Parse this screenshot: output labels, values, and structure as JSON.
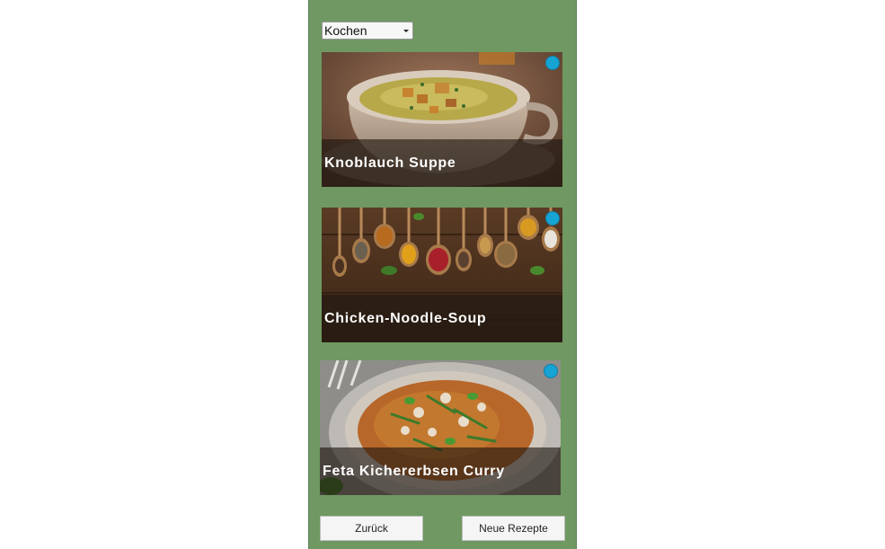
{
  "category_select": {
    "value": "Kochen"
  },
  "recipes": [
    {
      "title": "Knoblauch Suppe",
      "image": "garlic-soup-bowl",
      "marker_color": "#16a4d4"
    },
    {
      "title": "Chicken-Noodle-Soup",
      "image": "spice-spoons-on-wood",
      "marker_color": "#16a4d4"
    },
    {
      "title": "Feta Kichererbsen Curry",
      "image": "chickpea-curry-bowl",
      "marker_color": "#16a4d4"
    }
  ],
  "buttons": {
    "back_label": "Zurück",
    "new_label": "Neue Rezepte"
  },
  "colors": {
    "background": "#6f9862",
    "marker": "#16a4d4"
  }
}
